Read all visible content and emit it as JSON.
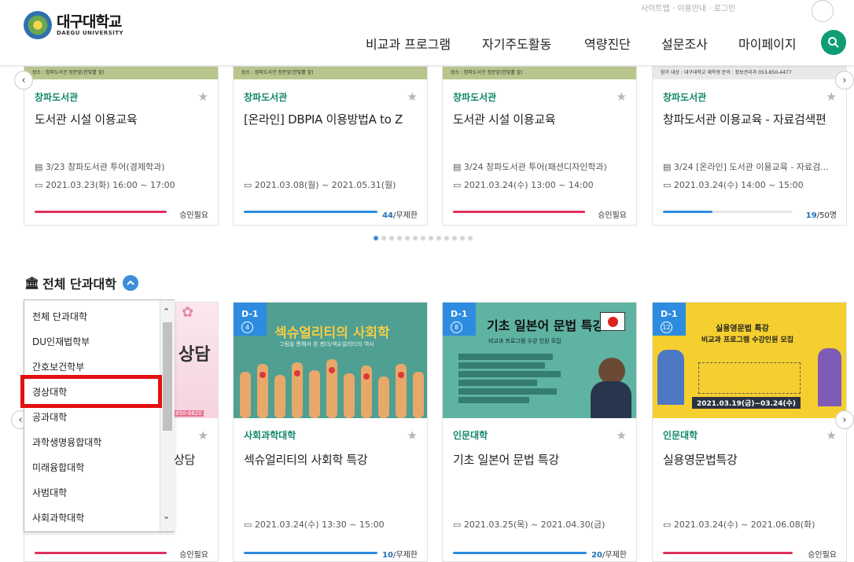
{
  "header": {
    "logo_ko": "대구대학교",
    "logo_en": "DAEGU UNIVERSITY",
    "util": "사이트맵 · 이용안내 · 로그인",
    "nav": [
      "비교과 프로그램",
      "자기주도활동",
      "역량진단",
      "설문조사",
      "마이페이지"
    ]
  },
  "row1": [
    {
      "thumb": "장소 : 참파도서관 정문앞(한빛홀 앞)",
      "category": "창파도서관",
      "title": "도서관 시설 이용교육",
      "line1": "3/23 창파도서관 투어(경제학과)",
      "date": "2021.03.23(화) 16:00 ~ 17:00",
      "progress": 1.0,
      "color": "#e0325e",
      "status": "승인필요",
      "count": ""
    },
    {
      "thumb": "장소 : 참파도서관 정문앞(한빛홀 앞)",
      "category": "창파도서관",
      "title": "[온라인] DBPIA 이용방법A to Z",
      "line1": "",
      "date": "2021.03.08(월) ~ 2021.05.31(월)",
      "progress": 1.0,
      "color": "#2d8ce0",
      "status": "/무제한",
      "count": "44"
    },
    {
      "thumb": "장소 : 참파도서관 정문앞(한빛홀 앞)",
      "category": "창파도서관",
      "title": "도서관 시설 이용교육",
      "line1": "3/24 창파도서관 투어(패션디자인학과)",
      "date": "2021.03.24(수) 13:00 ~ 14:00",
      "progress": 1.0,
      "color": "#e0325e",
      "status": "승인필요",
      "count": ""
    },
    {
      "thumb": "참가 대상 : 대구대학교 재학생        문의 : 정보관리과 053-850-4477",
      "category": "창파도서관",
      "title": "창파도서관 이용교육 - 자료검색편",
      "line1": "3/24 [온라인] 도서관 이용교육 - 자료검...",
      "date": "2021.03.24(수) 14:00 ~ 15:00",
      "progress": 0.38,
      "color": "#2d8ce0",
      "status": "/50명",
      "count": "19"
    }
  ],
  "section": {
    "title": "전체 단과대학"
  },
  "dropdown": {
    "items": [
      "전체 단과대학",
      "DU인재법학부",
      "간호보건학부",
      "경상대학",
      "공과대학",
      "과학생명융합대학",
      "미래융합대학",
      "사범대학",
      "사회과학대학"
    ],
    "selected": "경상대학"
  },
  "row2_first": {
    "poster_text": "상담",
    "poster_sub": "850-6820",
    "title": "상담",
    "status": "승인필요"
  },
  "row2": [
    {
      "badge": "D-1",
      "num": "4",
      "poster_title": "섹슈얼리티의 사회학",
      "poster_sub": "그림을 통해서 본 젠더/섹슈얼리티의 역사",
      "category": "사회과학대학",
      "title": "섹슈얼리티의 사회학 특강",
      "date": "2021.03.24(수) 13:30 ~ 15:00",
      "progress": 1.0,
      "color": "#2d8ce0",
      "status": "/무제한",
      "count": "10"
    },
    {
      "badge": "D-1",
      "num": "8",
      "poster_title": "기초 일본어 문법 특강",
      "poster_sub": "비교과 프로그램 수강 인원 모집",
      "category": "인문대학",
      "title": "기초 일본어 문법 특강",
      "date": "2021.03.25(목) ~ 2021.04.30(금)",
      "progress": 1.0,
      "color": "#2d8ce0",
      "status": "/무제한",
      "count": "20"
    },
    {
      "badge": "D-1",
      "num": "12",
      "poster_title": "실용영문법 특강",
      "poster_sub": "비교과 프로그램 수강인원 모집",
      "poster_date": "2021.03.19(금)~03.24(수)",
      "category": "인문대학",
      "title": "실용영문법특강",
      "date": "2021.03.24(수) ~ 2021.06.08(화)",
      "progress": 1.0,
      "color": "#e0325e",
      "status": "승인필요",
      "count": ""
    }
  ],
  "carousel": {
    "dots": 13,
    "active": 0
  }
}
